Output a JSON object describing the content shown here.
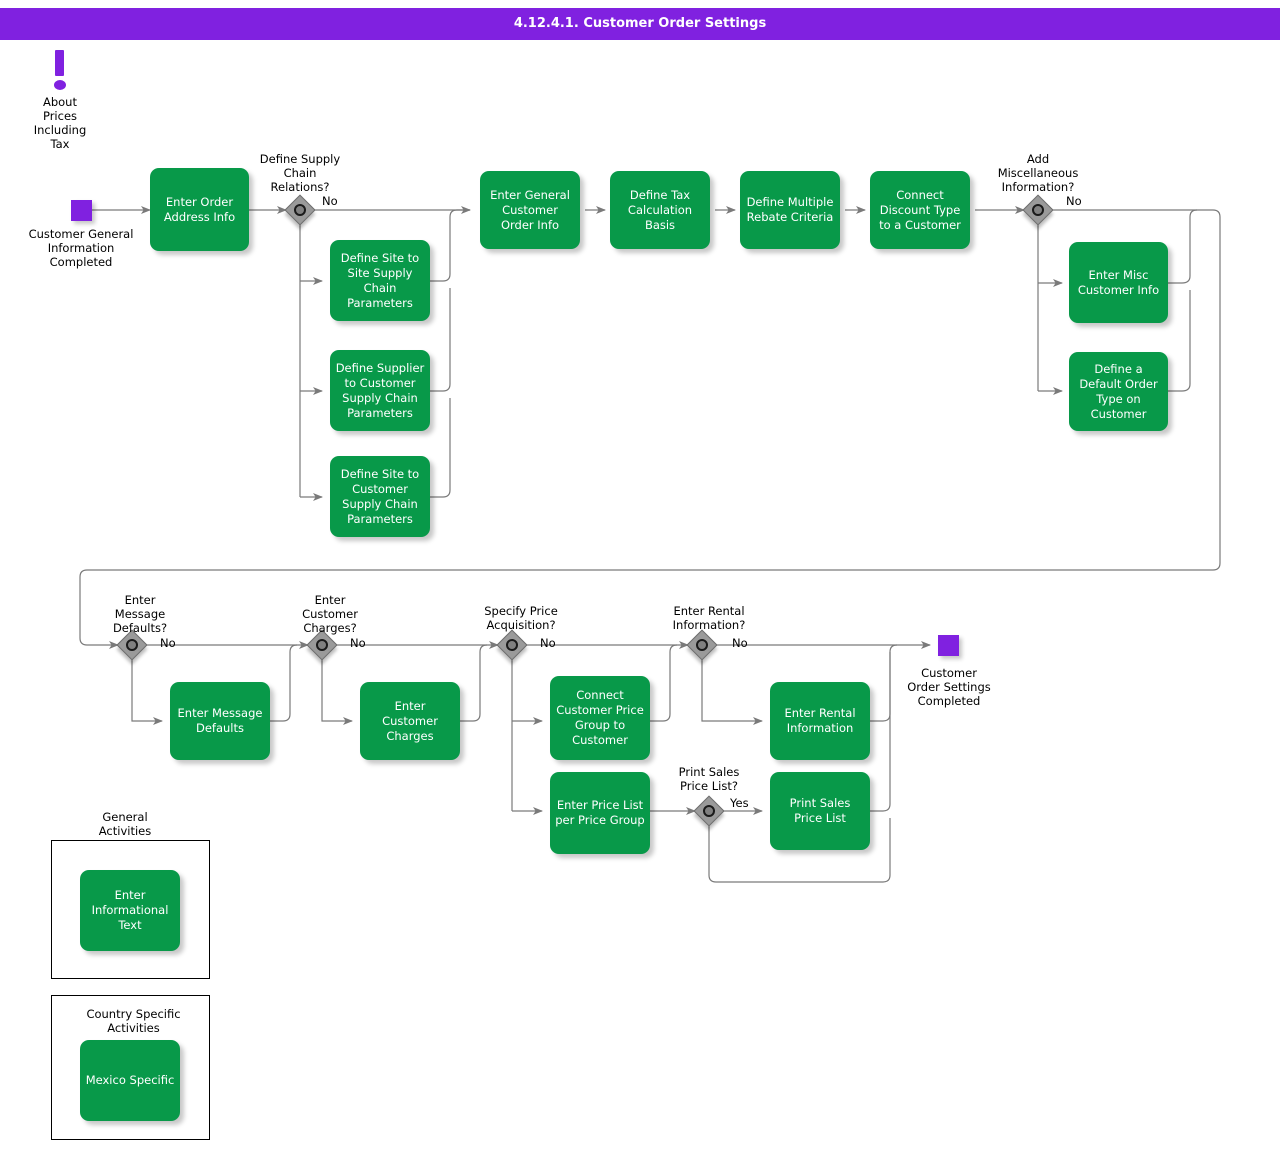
{
  "header": {
    "title": "4.12.4.1. Customer Order Settings",
    "background": "#8021e0",
    "text_color": "#ffffff"
  },
  "colors": {
    "activity_green": "#089949",
    "terminator_purple": "#8021e0",
    "gateway_gray": "#9a9a9a",
    "connector_gray": "#7a7a7a",
    "canvas": "#ffffff"
  },
  "annotations": {
    "info_marker": {
      "icon": "exclamation-icon",
      "label": "About\nPrices\nIncluding\nTax"
    }
  },
  "terminators": {
    "start": {
      "label": "Customer General\nInformation\nCompleted"
    },
    "end": {
      "label": "Customer\nOrder Settings\nCompleted"
    }
  },
  "activities": {
    "enter_order_address_info": "Enter Order\nAddress Info",
    "define_site_to_site": "Define Site to\nSite Supply\nChain\nParameters",
    "define_supplier_to_customer": "Define Supplier\nto Customer\nSupply Chain\nParameters",
    "define_site_to_customer": "Define Site to\nCustomer\nSupply Chain\nParameters",
    "enter_general_customer_order_info": "Enter General\nCustomer Order\nInfo",
    "define_tax_calculation_basis": "Define Tax\nCalculation\nBasis",
    "define_multiple_rebate_criteria": "Define Multiple\nRebate\nCriteria",
    "connect_discount_type": "Connect\nDiscount Type to\na Customer",
    "enter_misc_customer_info": "Enter Misc\nCustomer Info",
    "define_default_order_type": "Define a Default\nOrder Type on\nCustomer",
    "enter_message_defaults": "Enter Message\nDefaults",
    "enter_customer_charges": "Enter Customer\nCharges",
    "connect_customer_price_group": "Connect\nCustomer Price\nGroup to\nCustomer",
    "enter_price_list_per_price_group": "Enter Price List\nper Price Group",
    "enter_rental_information": "Enter Rental\nInformation",
    "print_sales_price_list": "Print Sales Price\nList",
    "enter_informational_text": "Enter\nInformational\nText",
    "mexico_specific": "Mexico Specific"
  },
  "gateways": {
    "define_supply_chain_relations": {
      "question": "Define Supply\nChain\nRelations?",
      "branch_label": "No"
    },
    "add_miscellaneous_information": {
      "question": "Add\nMiscellaneous\nInformation?",
      "branch_label": "No"
    },
    "enter_message_defaults": {
      "question": "Enter\nMessage\nDefaults?",
      "branch_label": "No"
    },
    "enter_customer_charges": {
      "question": "Enter\nCustomer\nCharges?",
      "branch_label": "No"
    },
    "specify_price_acquisition": {
      "question": "Specify Price\nAcquisition?",
      "branch_label": "No"
    },
    "enter_rental_information": {
      "question": "Enter Rental\nInformation?",
      "branch_label": "No"
    },
    "print_sales_price_list": {
      "question": "Print Sales\nPrice List?",
      "branch_label": "Yes"
    }
  },
  "legend": {
    "general_activities": {
      "title": "General\nActivities"
    },
    "country_specific_activities": {
      "title": "Country Specific Activities"
    }
  }
}
